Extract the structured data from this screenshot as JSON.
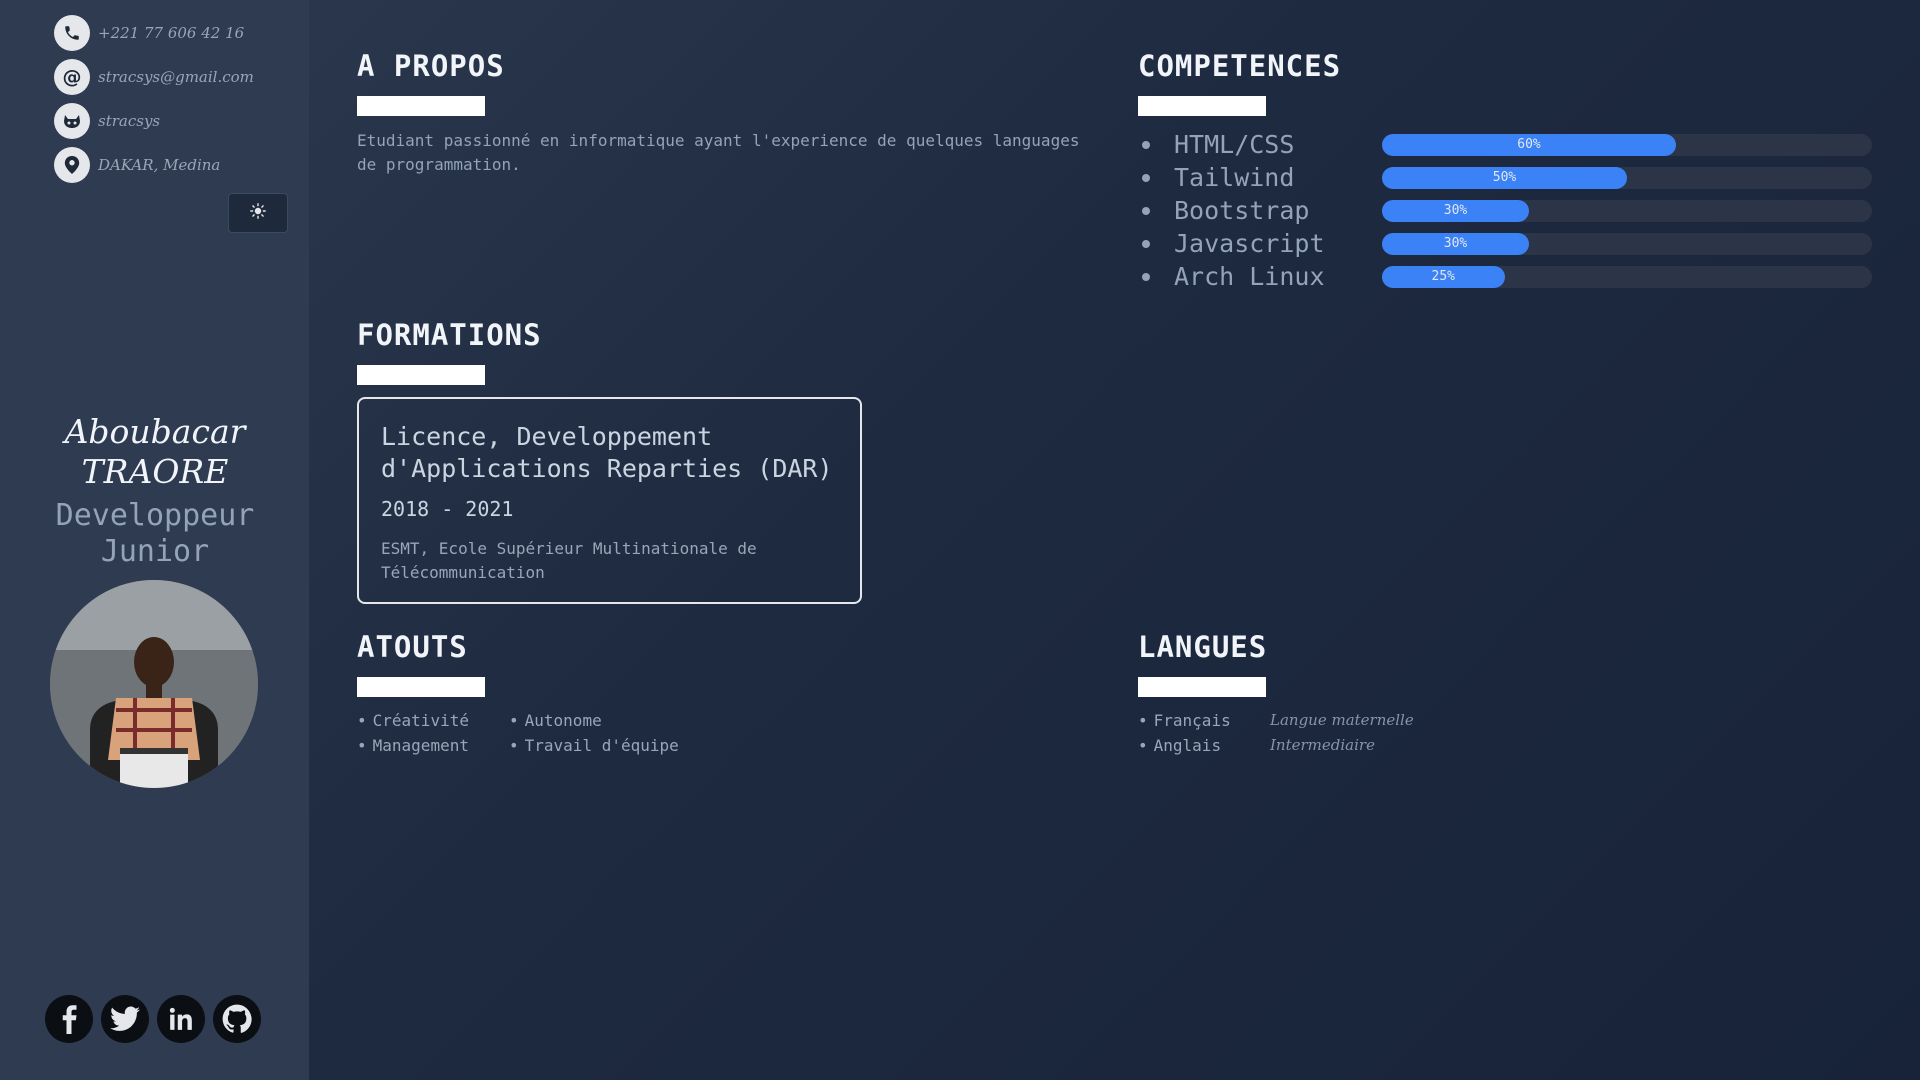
{
  "contact": {
    "phone": "+221 77 606 42 16",
    "email": "stracsys@gmail.com",
    "github": "stracsys",
    "location": "DAKAR, Medina"
  },
  "theme_toggle": {
    "icon": "sun-icon"
  },
  "profile": {
    "first_name": "Aboubacar",
    "last_name": "TRAORE",
    "role_line1": "Developpeur",
    "role_line2": "Junior"
  },
  "socials": [
    "facebook-icon",
    "twitter-icon",
    "linkedin-icon",
    "github-icon"
  ],
  "about": {
    "title": "A PROPOS",
    "text": "Etudiant passionné en informatique ayant l'experience de quelques languages de programmation."
  },
  "formations": {
    "title": "FORMATIONS",
    "items": [
      {
        "degree": "Licence, Developpement d'Applications Reparties (DAR)",
        "years": "2018 - 2021",
        "school": "ESMT, Ecole Supérieur Multinationale de Télécommunication"
      }
    ]
  },
  "competences": {
    "title": "COMPETENCES",
    "items": [
      {
        "name": "HTML/CSS",
        "percent": 60,
        "label": "60%"
      },
      {
        "name": "Tailwind",
        "percent": 50,
        "label": "50%"
      },
      {
        "name": "Bootstrap",
        "percent": 30,
        "label": "30%"
      },
      {
        "name": "Javascript",
        "percent": 30,
        "label": "30%"
      },
      {
        "name": "Arch Linux",
        "percent": 25,
        "label": "25%"
      }
    ]
  },
  "atouts": {
    "title": "ATOUTS",
    "col1": [
      "Créativité",
      "Management"
    ],
    "col2": [
      "Autonome",
      "Travail d'équipe"
    ]
  },
  "langues": {
    "title": "LANGUES",
    "items": [
      {
        "name": "Français",
        "level": "Langue maternelle"
      },
      {
        "name": "Anglais",
        "level": "Intermediaire"
      }
    ]
  },
  "colors": {
    "accent": "#3b82f6",
    "sidebar": "#2e3b51"
  }
}
